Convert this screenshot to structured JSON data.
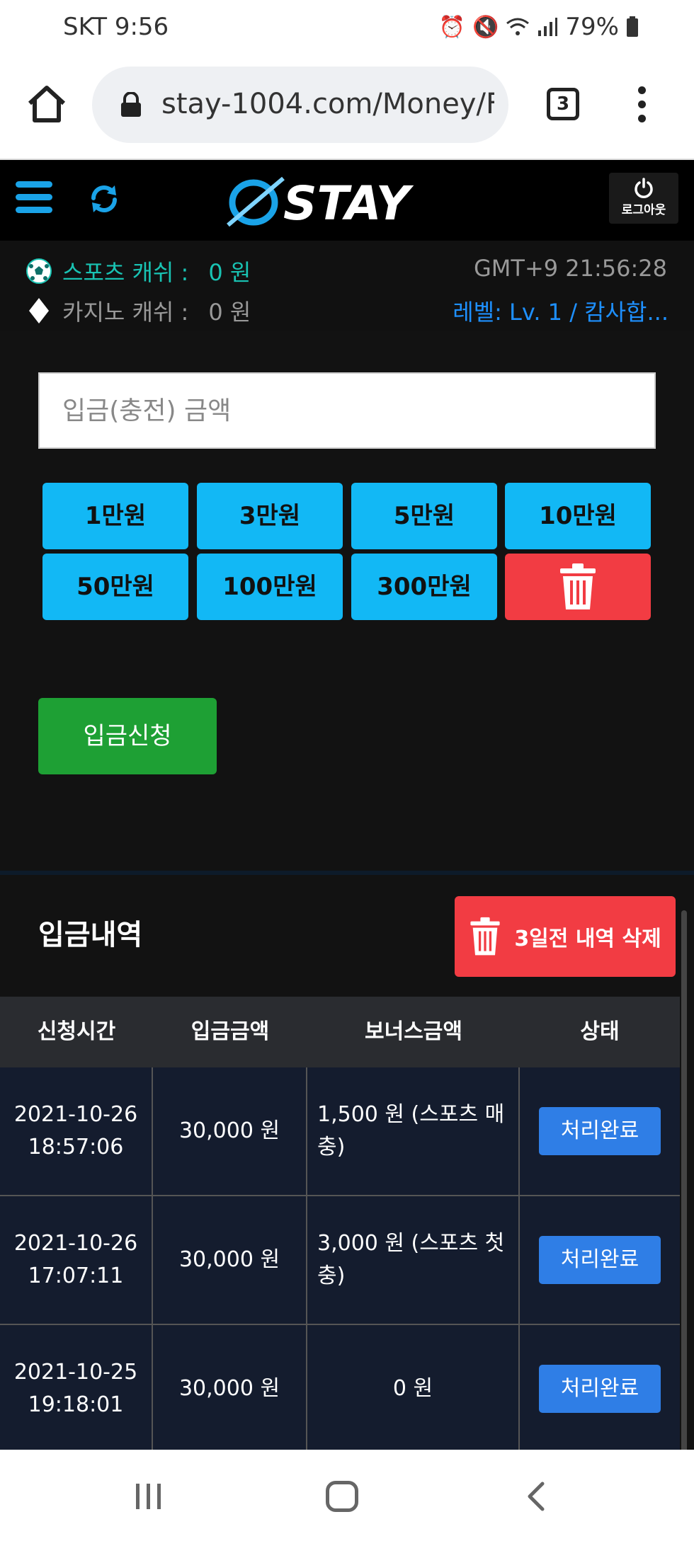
{
  "status_bar": {
    "carrier_time": "SKT  9:56",
    "battery": "79%",
    "icons": [
      "alarm-icon",
      "mute-icon",
      "wifi-icon",
      "signal-icon",
      "battery-icon"
    ]
  },
  "browser": {
    "url": "stay-1004.com/Money/F",
    "tab_count": "3"
  },
  "header": {
    "logo_text": "STAY",
    "logout_label": "로그아웃"
  },
  "info": {
    "sports_label": "스포츠 캐쉬 :",
    "sports_value": "0 원",
    "casino_label": "카지노 캐쉬 :",
    "casino_value": "0 원",
    "clock": "GMT+9 21:56:28",
    "level": "레벨: Lv. 1 / 캄사합..."
  },
  "deposit": {
    "placeholder": "입금(충전) 금액",
    "amount_buttons": [
      "1만원",
      "3만원",
      "5만원",
      "10만원",
      "50만원",
      "100만원",
      "300만원"
    ],
    "submit_label": "입금신청"
  },
  "history": {
    "title": "입금내역",
    "delete_label": "3일전 내역 삭제",
    "columns": [
      "신청시간",
      "입금금액",
      "보너스금액",
      "상태"
    ],
    "rows": [
      {
        "date": "2021-10-26",
        "time": "18:57:06",
        "amount": "30,000 원",
        "bonus": "1,500 원 (스포츠 매충)",
        "status": "처리완료"
      },
      {
        "date": "2021-10-26",
        "time": "17:07:11",
        "amount": "30,000 원",
        "bonus": "3,000 원 (스포츠 첫충)",
        "status": "처리완료"
      },
      {
        "date": "2021-10-25",
        "time": "19:18:01",
        "amount": "30,000 원",
        "bonus": "0 원",
        "status": "처리완료"
      }
    ]
  },
  "colors": {
    "accent_blue": "#12b8f5",
    "delete_red": "#f23c43",
    "submit_green": "#1ea034",
    "status_blue": "#2f7ee6",
    "sports_teal": "#19c3b3",
    "level_blue": "#1e90ff"
  }
}
